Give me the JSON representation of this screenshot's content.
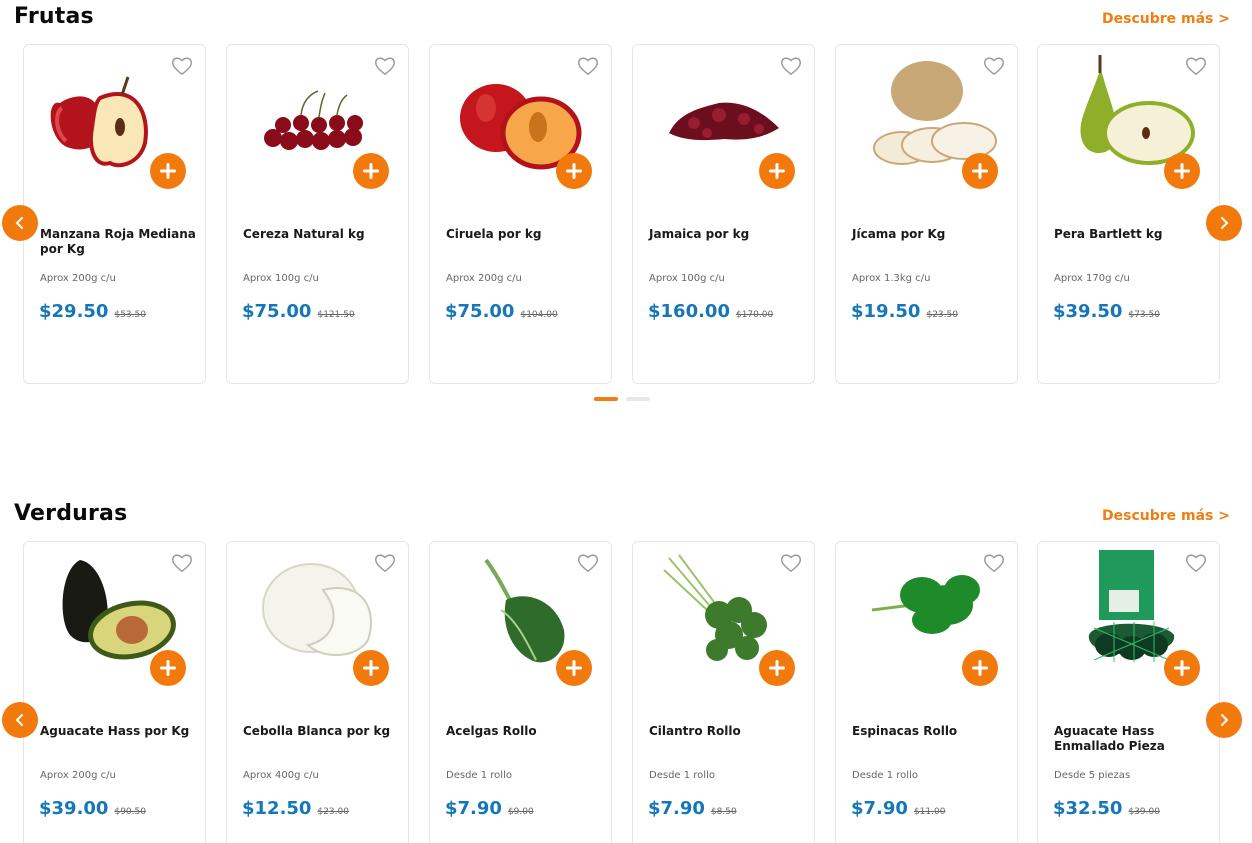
{
  "sections": [
    {
      "title": "Frutas",
      "more_link": "Descubre más >",
      "products": [
        {
          "name": "Manzana Roja Mediana por Kg",
          "desc": "Aprox 200g c/u",
          "price": "$29.50",
          "old_price": "$53.50",
          "image": "apple-image"
        },
        {
          "name": "Cereza Natural kg",
          "desc": "Aprox 100g c/u",
          "price": "$75.00",
          "old_price": "$121.50",
          "image": "cherries-image"
        },
        {
          "name": "Ciruela por kg",
          "desc": "Aprox 200g c/u",
          "price": "$75.00",
          "old_price": "$104.00",
          "image": "plum-image"
        },
        {
          "name": "Jamaica por kg",
          "desc": "Aprox 100g c/u",
          "price": "$160.00",
          "old_price": "$170.00",
          "image": "hibiscus-image"
        },
        {
          "name": "Jícama por Kg",
          "desc": "Aprox 1.3kg c/u",
          "price": "$19.50",
          "old_price": "$23.50",
          "image": "jicama-image"
        },
        {
          "name": "Pera Bartlett kg",
          "desc": "Aprox 170g c/u",
          "price": "$39.50",
          "old_price": "$73.50",
          "image": "pear-image"
        }
      ]
    },
    {
      "title": "Verduras",
      "more_link": "Descubre más >",
      "products": [
        {
          "name": "Aguacate Hass por Kg",
          "desc": "Aprox 200g c/u",
          "price": "$39.00",
          "old_price": "$90.50",
          "image": "avocado-image"
        },
        {
          "name": "Cebolla Blanca por kg",
          "desc": "Aprox 400g c/u",
          "price": "$12.50",
          "old_price": "$23.00",
          "image": "onion-image"
        },
        {
          "name": "Acelgas Rollo",
          "desc": "Desde 1 rollo",
          "price": "$7.90",
          "old_price": "$9.00",
          "image": "chard-image"
        },
        {
          "name": "Cilantro Rollo",
          "desc": "Desde 1 rollo",
          "price": "$7.90",
          "old_price": "$8.50",
          "image": "cilantro-image"
        },
        {
          "name": "Espinacas Rollo",
          "desc": "Desde 1 rollo",
          "price": "$7.90",
          "old_price": "$11.00",
          "image": "spinach-image"
        },
        {
          "name": "Aguacate Hass Enmallado Pieza",
          "desc": "Desde 5 piezas",
          "price": "$32.50",
          "old_price": "$39.00",
          "image": "avocado-mesh-image"
        }
      ]
    }
  ],
  "colors": {
    "accent": "#f27a0d",
    "price": "#1677b8",
    "link": "#f07e12"
  },
  "icons": {
    "favorite": "heart-outline-icon",
    "add": "plus-icon",
    "prev": "chevron-left-icon",
    "next": "chevron-right-icon"
  }
}
